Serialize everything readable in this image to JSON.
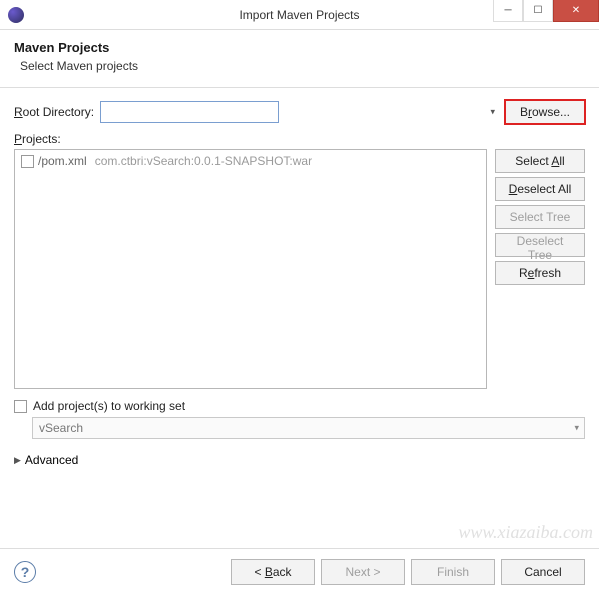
{
  "window": {
    "title": "Import Maven Projects"
  },
  "header": {
    "title": "Maven Projects",
    "subtitle": "Select Maven projects"
  },
  "labels": {
    "root_dir": "Root Directory:",
    "projects": "Projects:",
    "add_ws": "Add project(s) to working set",
    "advanced": "Advanced"
  },
  "root_input": {
    "value": ""
  },
  "buttons": {
    "browse": "Browse...",
    "select_all": "Select All",
    "deselect_all": "Deselect All",
    "select_tree": "Select Tree",
    "deselect_tree": "Deselect Tree",
    "refresh": "Refresh",
    "back": "< Back",
    "next": "Next >",
    "finish": "Finish",
    "cancel": "Cancel"
  },
  "projects_list": [
    {
      "path": "/pom.xml",
      "gav": "com.ctbri:vSearch:0.0.1-SNAPSHOT:war",
      "checked": false
    }
  ],
  "working_set": {
    "selected": "vSearch"
  },
  "watermark": "www.xiazaiba.com"
}
